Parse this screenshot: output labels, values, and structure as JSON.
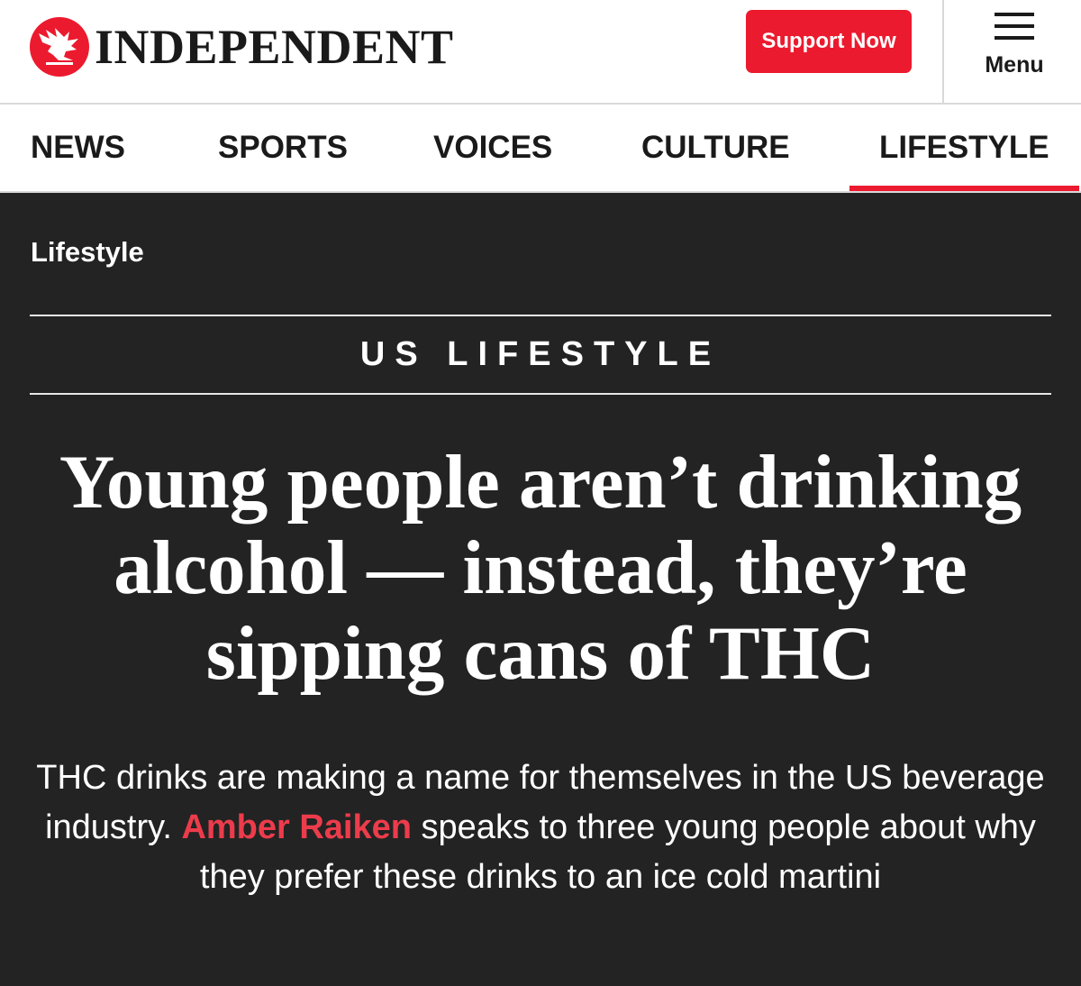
{
  "brand": {
    "name": "INDEPENDENT",
    "accent_color": "#ec1a2e"
  },
  "header": {
    "support_label": "Support Now",
    "menu_label": "Menu",
    "logo_icon": "eagle-icon",
    "menu_icon": "hamburger-icon"
  },
  "nav": {
    "items": [
      {
        "label": "NEWS"
      },
      {
        "label": "SPORTS"
      },
      {
        "label": "VOICES"
      },
      {
        "label": "CULTURE"
      },
      {
        "label": "LIFESTYLE",
        "active": true
      }
    ]
  },
  "article": {
    "section": "Lifestyle",
    "kicker": "US LIFESTYLE",
    "headline": "Young people aren’t drinking alcohol — instead, they’re sipping cans of THC",
    "standfirst_before": "THC drinks are making a name for themselves in the US beverage industry. ",
    "author": "Amber Raiken",
    "standfirst_after": " speaks to three young people about why they prefer these drinks to an ice cold martini"
  }
}
